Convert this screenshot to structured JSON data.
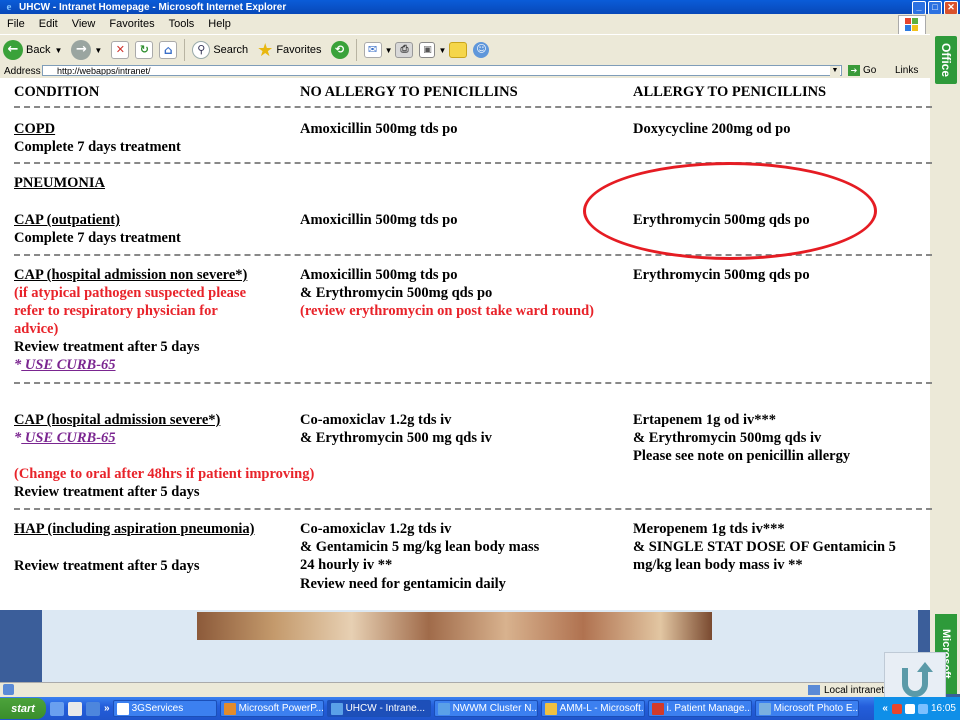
{
  "window": {
    "title": "UHCW - Intranet Homepage - Microsoft Internet Explorer",
    "minimize": "_",
    "maximize": "□",
    "close": "✕"
  },
  "menu": [
    "File",
    "Edit",
    "View",
    "Favorites",
    "Tools",
    "Help"
  ],
  "toolbar": {
    "back_label": "Back",
    "search_label": "Search",
    "favorites_label": "Favorites"
  },
  "address": {
    "label": "Address",
    "url": "http://webapps/intranet/",
    "go_label": "Go",
    "links_label": "Links"
  },
  "side": {
    "office_label": "Office",
    "microsoft_label": "Microsoft"
  },
  "guideline": {
    "headers": {
      "condition": "CONDITION",
      "no_allergy": "NO ALLERGY TO PENICILLINS",
      "allergy": "ALLERGY TO PENICILLINS"
    },
    "copd": {
      "title": "COPD",
      "note": "Complete 7 days treatment",
      "no_allergy": "Amoxicillin 500mg tds po",
      "allergy": "Doxycycline 200mg od po"
    },
    "pneumonia_title": "PNEUMONIA",
    "cap_out": {
      "title": "CAP (outpatient)",
      "note": "Complete 7 days treatment",
      "no_allergy": "Amoxicillin 500mg tds po",
      "allergy": "Erythromycin 500mg qds po"
    },
    "cap_non_severe": {
      "title": "CAP (hospital admission non severe*)",
      "red_1": "(if atypical pathogen suspected please",
      "red_2": "refer to respiratory physician for",
      "red_3": "advice)",
      "note": "Review treatment after 5 days",
      "star": "*",
      "curb": " USE CURB-65",
      "no_allergy_1": "Amoxicillin 500mg tds po",
      "no_allergy_2": "& Erythromycin 500mg qds po",
      "no_allergy_red": "(review erythromycin on post take ward round)",
      "allergy": "Erythromycin 500mg qds po"
    },
    "cap_severe": {
      "title": "CAP (hospital admission severe*)",
      "star": "*",
      "curb": " USE CURB-65",
      "red": "(Change to oral after 48hrs if patient improving)",
      "note": "Review treatment after 5 days",
      "no_allergy_1": "Co-amoxiclav 1.2g tds iv",
      "no_allergy_2": "& Erythromycin 500 mg qds iv",
      "allergy_1": "Ertapenem 1g od iv***",
      "allergy_2": "& Erythromycin 500mg qds iv",
      "allergy_3": "Please see note on penicillin allergy"
    },
    "hap": {
      "title": "HAP (including aspiration pneumonia)",
      "note": "Review treatment after 5 days",
      "no_allergy_1": "Co-amoxiclav 1.2g tds iv",
      "no_allergy_2": "& Gentamicin 5 mg/kg lean body mass",
      "no_allergy_3": "24 hourly iv **",
      "no_allergy_4": "Review need for gentamicin daily",
      "allergy_1": "Meropenem 1g tds iv***",
      "allergy_2": "& SINGLE STAT DOSE OF Gentamicin 5",
      "allergy_3": "mg/kg lean body mass iv **"
    }
  },
  "status": {
    "zone": "Local intranet"
  },
  "taskbar": {
    "start": "start",
    "chevron": "»",
    "tasks": [
      "3GServices",
      "Microsoft PowerP...",
      "UHCW - Intrane...",
      "NWWM Cluster N...",
      "AMM-L - Microsoft...",
      "i. Patient Manage...",
      "Microsoft Photo E..."
    ],
    "tray_chevron": "«",
    "clock": "16:05"
  },
  "colors": {
    "highlight_ellipse": "#e51c23",
    "red_text": "#e8232a",
    "link": "#7a2590",
    "office_green": "#2e9a3a"
  }
}
